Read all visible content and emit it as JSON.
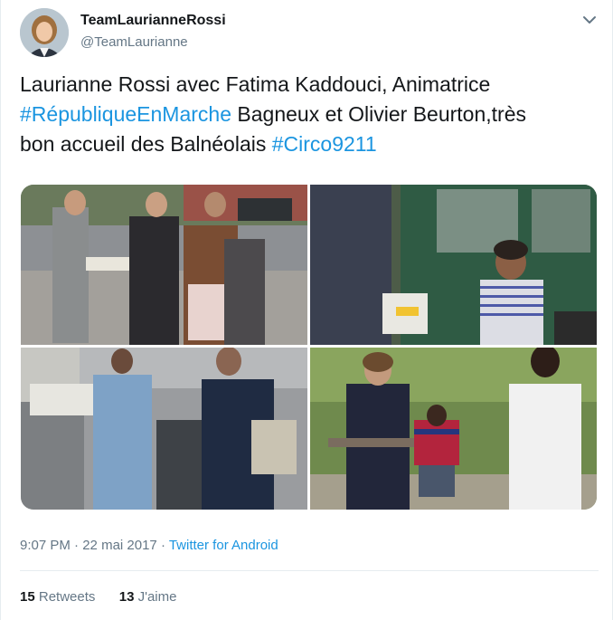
{
  "author": {
    "name": "TeamLaurianneRossi",
    "handle": "@TeamLaurianne"
  },
  "tweet": {
    "line1": "Laurianne Rossi avec Fatima Kaddouci, Animatrice",
    "hashtag1": "#RépubliqueEnMarche",
    "line2": "  Bagneux et Olivier Beurton,très",
    "line3": "bon accueil des Balnéolais ",
    "hashtag2": "#Circo9211"
  },
  "meta": {
    "time": "9:07 PM",
    "sep": " · ",
    "date": "22 mai 2017",
    "sep2": " · ",
    "source": "Twitter for Android"
  },
  "stats": {
    "retweets_count": "15",
    "retweets_label": " Retweets",
    "likes_count": "13",
    "likes_label": " J'aime"
  },
  "icons": {
    "avatar": "profile-photo",
    "menu": "chevron-down-icon"
  },
  "colors": {
    "link": "#1b95e0",
    "muted": "#657786",
    "text": "#14171a"
  }
}
